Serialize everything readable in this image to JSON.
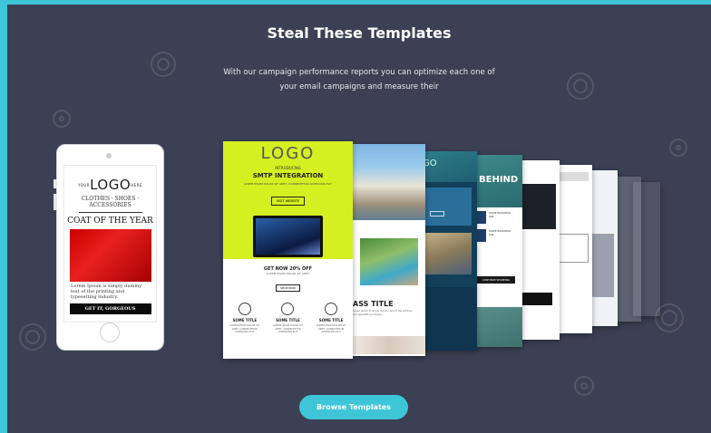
{
  "header": {
    "title": "Steal These Templates",
    "subtitle": "With our campaign performance reports you can optimize each one of your email campaigns and measure their"
  },
  "phone_template": {
    "logo_side": "YOUR",
    "logo": "LOGO",
    "logo_side_right": "HERE",
    "menu": "CLOTHES · SHOES · ACCESSORIES",
    "headline": "COAT OF THE YEAR",
    "body": "Lorem Ipsum is simply dummy text of the printing and typesetting industry.",
    "cta": "GET IT, GORGEOUS"
  },
  "template_1": {
    "logo": "LOGO",
    "intro": "INTRODUCING",
    "headline": "SMTP INTEGRATION",
    "desc": "LOREM IPSUM DOLOR SIT AMET, CONSECTETUR ADIPISCING ELIT",
    "button": "VISIT WEBSITE",
    "offer": "GET NOW 20% OFF",
    "offer_sub": "LOREM IPSUM DOLOR SIT AMET",
    "shop": "SHOP NOW",
    "columns": [
      {
        "title": "SOME TITLE",
        "text": "LOREM IPSUM DOLOR SIT AMET, CONSECTETUR ADIPISCING ELIT"
      },
      {
        "title": "SOME TITLE",
        "text": "LOREM IPSUM DOLOR SIT AMET, CONSECTETUR ADIPISCING ELIT"
      },
      {
        "title": "SOME TITLE",
        "text": "LOREM IPSUM DOLOR SIT AMET, CONSECTETUR ADIPISCING ELIT"
      }
    ]
  },
  "template_2": {
    "title": "ASS TITLE",
    "text": "Lorem Ipsum is simply dummy text of the printing and typesetting industry."
  },
  "template_3": {
    "logo": "GO",
    "button": "READ MORE"
  },
  "template_4": {
    "headline": "BEHIND",
    "product_a": "STAPE BACKPACK",
    "price_a": "$99",
    "product_b": "STAPE BACKPACK",
    "price_b": "$99",
    "button": "CONTINUE SHOPPING"
  },
  "template_5": {
    "button": "SHOP NOW"
  },
  "cta": {
    "browse_label": "Browse Templates"
  },
  "colors": {
    "background": "#3b4054",
    "accent": "#3ec6d8",
    "template_lime": "#d4f020"
  }
}
